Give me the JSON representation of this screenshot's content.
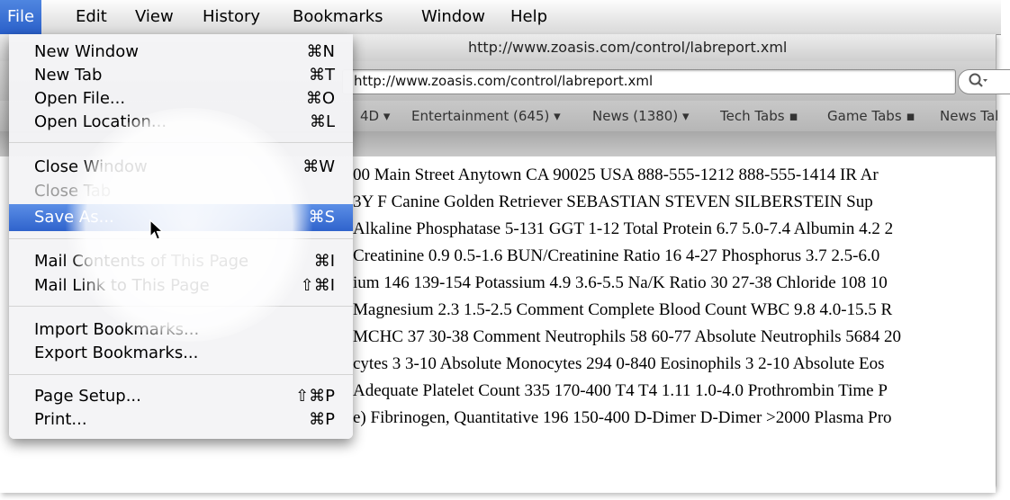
{
  "menubar": {
    "items": [
      "File",
      "Edit",
      "View",
      "History",
      "Bookmarks",
      "Window",
      "Help"
    ]
  },
  "window": {
    "title": "http://www.zoasis.com/control/labreport.xml",
    "address_value": "http://www.zoasis.com/control/labreport.xml",
    "search_icon": "magnifier-icon",
    "bookmarks_bar": [
      "4D ▾",
      "Entertainment (645) ▾",
      "News (1380) ▾",
      "Tech Tabs ▪",
      "Game Tabs ▪",
      "News Tal"
    ]
  },
  "page_text_lines": [
    "00 Main Street Anytown CA 90025 USA 888-555-1212 888-555-1414 IR Ar",
    "3Y F Canine Golden Retriever SEBASTIAN STEVEN SILBERSTEIN Sup",
    "Alkaline Phosphatase 5-131 GGT 1-12 Total Protein 6.7 5.0-7.4 Albumin 4.2 2",
    " Creatinine 0.9 0.5-1.6 BUN/Creatinine Ratio 16 4-27 Phosphorus 3.7 2.5-6.0",
    "ium 146 139-154 Potassium 4.9 3.6-5.5 Na/K Ratio 30 27-38 Chloride 108 10",
    "Magnesium 2.3 1.5-2.5 Comment Complete Blood Count WBC 9.8 4.0-15.5 R",
    "MCHC 37 30-38 Comment Neutrophils 58 60-77 Absolute Neutrophils 5684 20",
    "cytes 3 3-10 Absolute Monocytes 294 0-840 Eosinophils 3 2-10 Absolute Eos",
    "Adequate Platelet Count 335 170-400 T4 T4 1.11 1.0-4.0 Prothrombin Time P",
    "e) Fibrinogen, Quantitative 196 150-400 D-Dimer D-Dimer >2000 Plasma Pro"
  ],
  "file_menu": {
    "items": [
      {
        "label": "New Window",
        "shortcut": "⌘N"
      },
      {
        "label": "New Tab",
        "shortcut": "⌘T"
      },
      {
        "label": "Open File...",
        "shortcut": "⌘O"
      },
      {
        "label": "Open Location...",
        "shortcut": "⌘L"
      },
      {
        "label": "Close Window",
        "shortcut": "⌘W"
      },
      {
        "label": "Close Tab",
        "shortcut": "",
        "disabled": true
      },
      {
        "label": "Save As...",
        "shortcut": "⌘S",
        "selected": true
      },
      {
        "label": "Mail Contents of This Page",
        "shortcut": "⌘I"
      },
      {
        "label": "Mail Link to This Page",
        "shortcut": "⇧⌘I"
      },
      {
        "label": "Import Bookmarks...",
        "shortcut": ""
      },
      {
        "label": "Export Bookmarks...",
        "shortcut": ""
      },
      {
        "label": "Page Setup...",
        "shortcut": "⇧⌘P"
      },
      {
        "label": "Print...",
        "shortcut": "⌘P"
      }
    ]
  },
  "colors": {
    "menu_highlight": "#2f63cc",
    "menubar_bg": "#e6e6e6",
    "disabled_text": "#9b9b9b"
  }
}
